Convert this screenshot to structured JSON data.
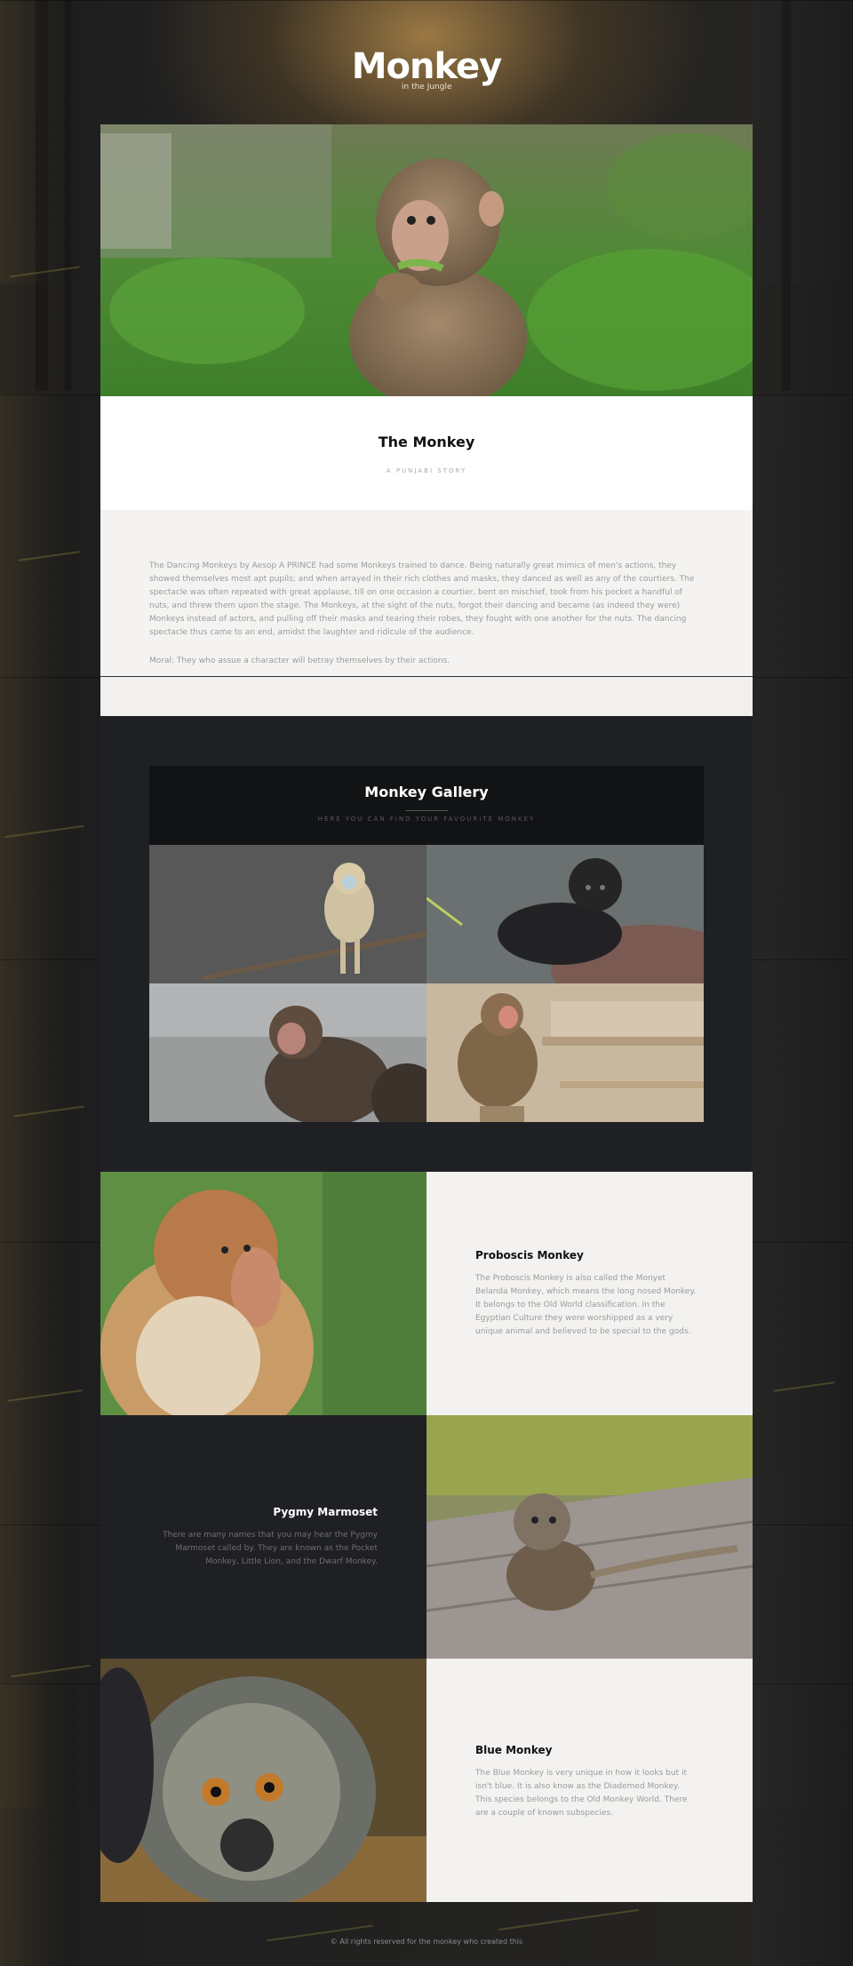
{
  "header": {
    "title": "Monkey",
    "subtitle": "in the Jungle"
  },
  "story": {
    "title": "The Monkey",
    "tagline": "A PUNJABI STORY",
    "body": "The Dancing Monkeys by Aesop A PRINCE had some Monkeys trained to dance. Being naturally great mimics of men's actions, they showed themselves most apt pupils; and when arrayed in their rich clothes and masks, they danced as well as any of the courtiers. The spectacle was often repeated with great applause, till on one occasion a courtier, bent on mischief, took from his pocket a handful of nuts, and threw them upon the stage. The Monkeys, at the sight of the nuts, forgot their dancing and became (as indeed they were) Monkeys instead of actors, and pulling off their masks and tearing their robes, they fought with one another for the nuts. The dancing spectacle thus came to an end, amidst the laughter and ridicule of the audience.",
    "moral": "Moral: They who assue a character will betray themselves by their actions."
  },
  "gallery": {
    "title": "Monkey Gallery",
    "subtitle": "HERE YOU CAN FIND YOUR FAVOURITE MONKEY"
  },
  "features": [
    {
      "title": "Proboscis Monkey",
      "text": "The Proboscis Monkey is also called the Monyet Belanda Monkey, which means the long nosed Monkey. It belongs to the Old World classification. In the Egyptian Culture they were worshipped as a very unique animal and believed to be special to the gods."
    },
    {
      "title": "Pygmy Marmoset",
      "text": "There are many names that you may hear the Pygmy Marmoset called by. They are known as the Pocket Monkey, Little Lion, and the Dwarf Monkey."
    },
    {
      "title": "Blue Monkey",
      "text": "The Blue Monkey is very unique in how it looks but it isn't blue. It is also know as the Diademed Monkey. This species belongs to the Old Monkey World. There are a couple of known subspecies."
    }
  ],
  "footer": {
    "text": "© All rights reserved for the monkey who created this"
  }
}
